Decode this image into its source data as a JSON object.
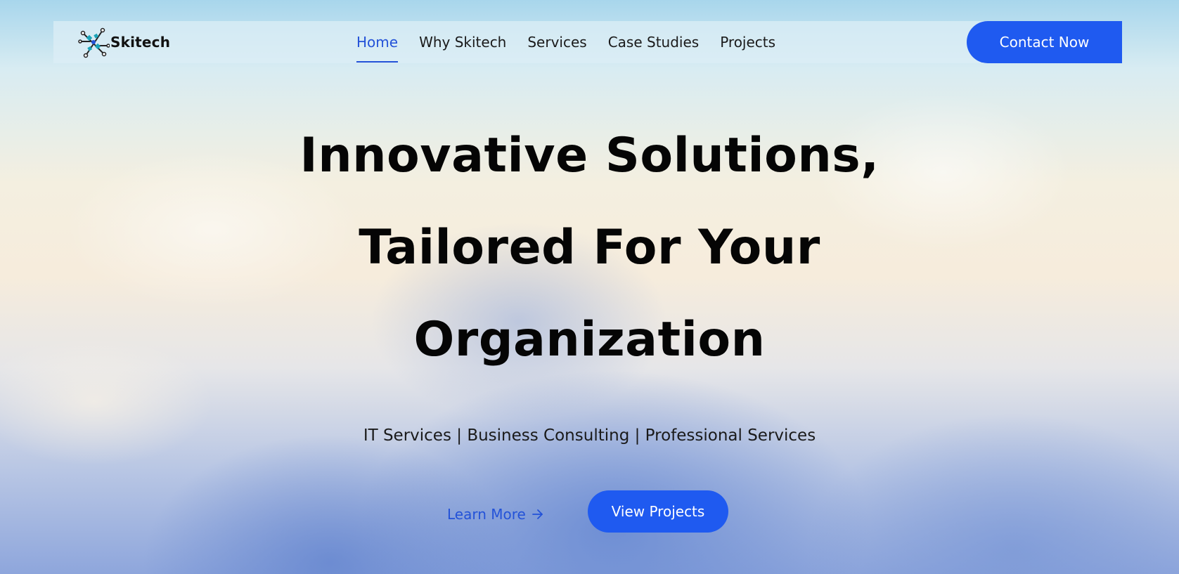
{
  "brand": {
    "name": "Skitech",
    "logo_icon": "circuit-logo-icon"
  },
  "nav": {
    "items": [
      {
        "label": "Home",
        "active": true
      },
      {
        "label": "Why Skitech",
        "active": false
      },
      {
        "label": "Services",
        "active": false
      },
      {
        "label": "Case Studies",
        "active": false
      },
      {
        "label": "Projects",
        "active": false
      }
    ],
    "contact_label": "Contact Now"
  },
  "hero": {
    "title_lines": [
      "Innovative Solutions,",
      "Tailored For Your",
      "Organization"
    ],
    "subtitle": "IT Services | Business Consulting | Professional Services",
    "learn_more_label": "Learn More",
    "learn_more_icon": "arrow-right-icon",
    "view_projects_label": "View Projects"
  },
  "colors": {
    "accent": "#1f5af0",
    "link": "#2352d8",
    "title": "#050505"
  }
}
